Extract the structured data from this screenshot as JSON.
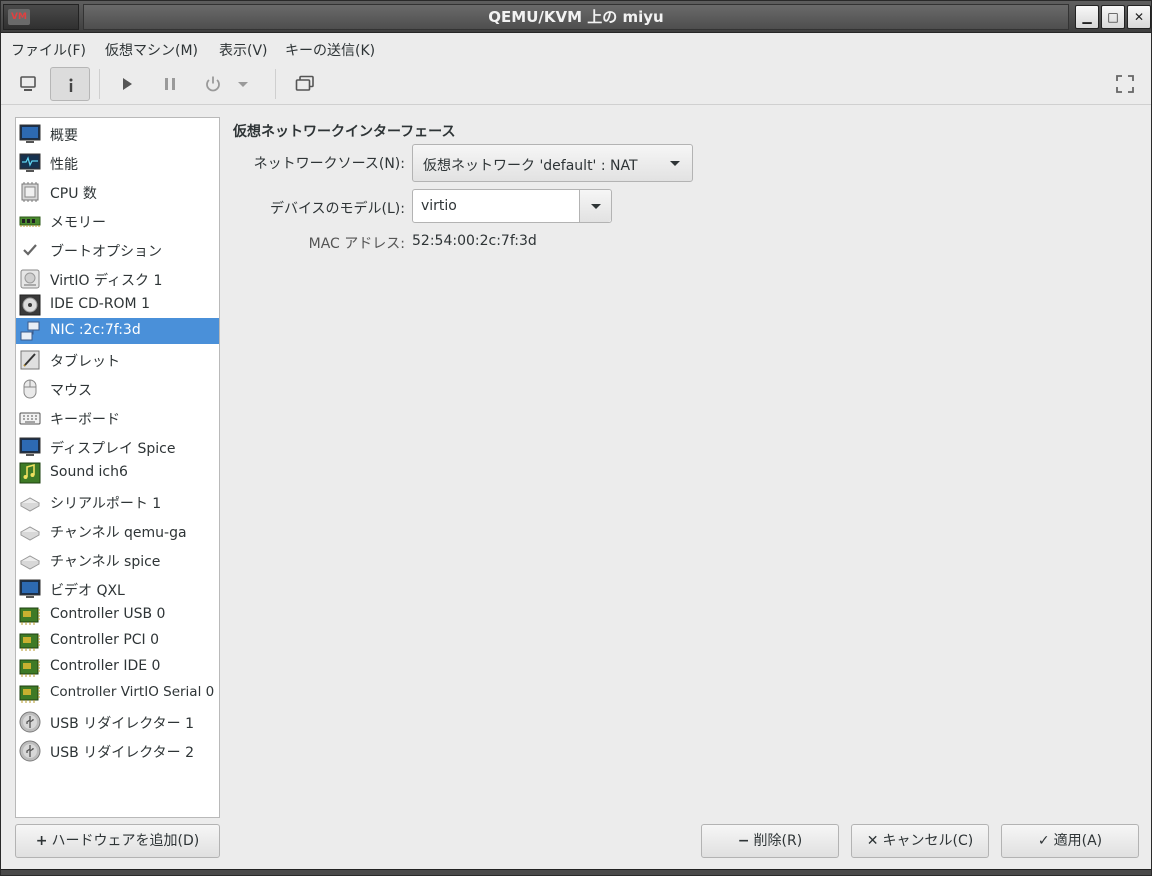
{
  "window": {
    "title": "QEMU/KVM 上の miyu",
    "logo_text": "VM",
    "controls": {
      "minimize": "▁",
      "maximize": "□",
      "close": "✕"
    }
  },
  "menu": [
    "ファイル(F)",
    "仮想マシン(M)",
    "表示(V)",
    "キーの送信(K)"
  ],
  "toolbar": {
    "icons": [
      "monitor-icon",
      "info-icon",
      "play-icon",
      "pause-icon",
      "power-icon",
      "dropdown-icon",
      "clone-icon",
      "fullscreen-icon"
    ],
    "active": "info-icon"
  },
  "sidebar": {
    "items": [
      {
        "label": "概要",
        "icon": "monitor-icon"
      },
      {
        "label": "性能",
        "icon": "monitor-graph-icon"
      },
      {
        "label": "CPU 数",
        "icon": "cpu-icon"
      },
      {
        "label": "メモリー",
        "icon": "memory-icon"
      },
      {
        "label": "ブートオプション",
        "icon": "check-icon"
      },
      {
        "label": "VirtIO ディスク 1",
        "icon": "harddisk-icon"
      },
      {
        "label": "IDE CD-ROM 1",
        "icon": "cdrom-icon"
      },
      {
        "label": "NIC :2c:7f:3d",
        "icon": "network-icon"
      },
      {
        "label": "タブレット",
        "icon": "tablet-icon"
      },
      {
        "label": "マウス",
        "icon": "mouse-icon"
      },
      {
        "label": "キーボード",
        "icon": "keyboard-icon"
      },
      {
        "label": "ディスプレイ Spice",
        "icon": "monitor-icon"
      },
      {
        "label": "Sound ich6",
        "icon": "sound-icon"
      },
      {
        "label": "シリアルポート 1",
        "icon": "serial-icon"
      },
      {
        "label": "チャンネル qemu-ga",
        "icon": "serial-icon"
      },
      {
        "label": "チャンネル spice",
        "icon": "serial-icon"
      },
      {
        "label": "ビデオ QXL",
        "icon": "monitor-icon"
      },
      {
        "label": "Controller USB 0",
        "icon": "controller-icon"
      },
      {
        "label": "Controller PCI 0",
        "icon": "controller-icon"
      },
      {
        "label": "Controller IDE 0",
        "icon": "controller-icon"
      },
      {
        "label": "Controller VirtIO Serial 0",
        "icon": "controller-icon"
      },
      {
        "label": "USB リダイレクター 1",
        "icon": "usb-icon"
      },
      {
        "label": "USB リダイレクター 2",
        "icon": "usb-icon"
      }
    ],
    "selected": 7
  },
  "nic": {
    "section_title": "仮想ネットワークインターフェース",
    "network_source_label": "ネットワークソース(N):",
    "network_source_value": "仮想ネットワーク 'default' : NAT",
    "device_model_label": "デバイスのモデル(L):",
    "device_model_value": "virtio",
    "mac_label": "MAC アドレス:",
    "mac_value": "52:54:00:2c:7f:3d"
  },
  "buttons": {
    "add_hardware": "ハードウェアを追加(D)",
    "add_glyph": "+",
    "remove": "削除(R)",
    "remove_glyph": "−",
    "cancel": "キャンセル(C)",
    "cancel_glyph": "✕",
    "apply": "適用(A)",
    "apply_glyph": "✓"
  }
}
